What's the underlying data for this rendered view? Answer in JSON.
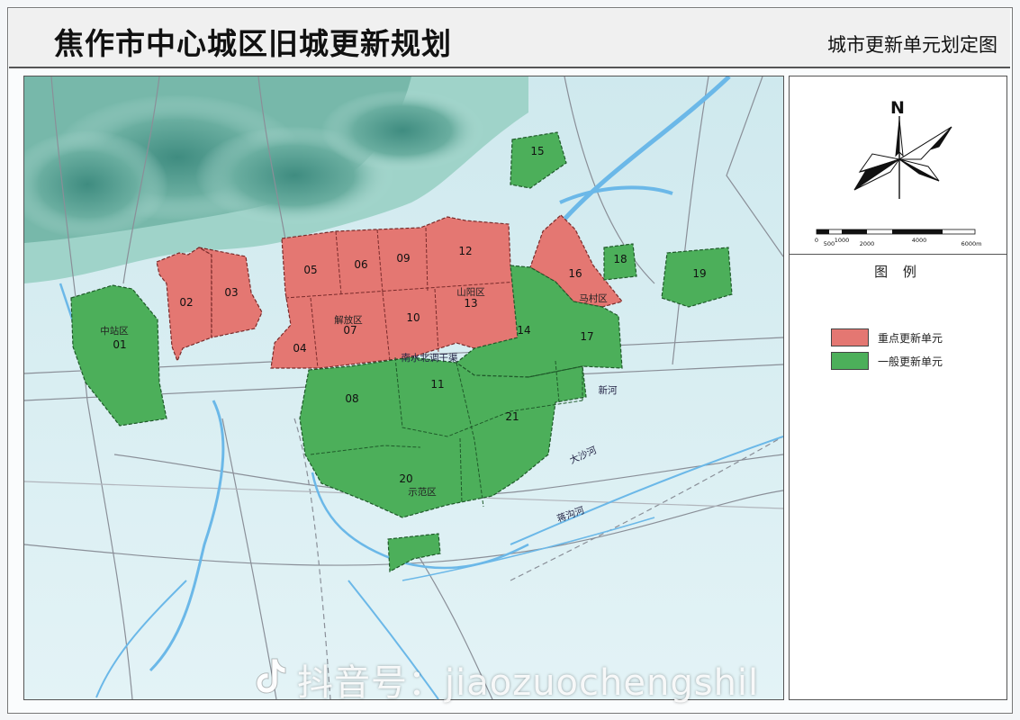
{
  "header": {
    "title": "焦作市中心城区旧城更新规划",
    "subtitle": "城市更新单元划定图"
  },
  "colors": {
    "key_unit_fill": "#e47772",
    "general_unit_fill": "#4caf5a",
    "river": "#6bb8e8",
    "mountain": "#5fa596",
    "plain": "#d8eff2"
  },
  "units": {
    "key": [
      "02",
      "03",
      "04",
      "05",
      "06",
      "07",
      "09",
      "10",
      "12",
      "13",
      "16"
    ],
    "general": [
      "01",
      "08",
      "11",
      "14",
      "15",
      "17",
      "18",
      "19",
      "20",
      "21"
    ],
    "labels": {
      "u01": "01",
      "u02": "02",
      "u03": "03",
      "u04": "04",
      "u05": "05",
      "u06": "06",
      "u07": "07",
      "u08": "08",
      "u09": "09",
      "u10": "10",
      "u11": "11",
      "u12": "12",
      "u13": "13",
      "u14": "14",
      "u15": "15",
      "u16": "16",
      "u17": "17",
      "u18": "18",
      "u19": "19",
      "u20": "20",
      "u21": "21"
    }
  },
  "districts": {
    "zhongzhan": "中站区",
    "jiefang": "解放区",
    "shanyang": "山阳区",
    "macun": "马村区",
    "shifan": "示范区"
  },
  "rivers": {
    "canal": "南水北调干渠",
    "xinhe": "新河",
    "dashahe": "大沙河",
    "wengouhe": "蒋沟河"
  },
  "compass": {
    "north_letter": "N",
    "icon": "north-arrow-icon"
  },
  "scale": {
    "ticks": [
      "0",
      "500",
      "1000",
      "2000",
      "4000",
      "6000m"
    ]
  },
  "legend": {
    "title": "图 例",
    "items": [
      {
        "label": "重点更新单元",
        "color": "#e47772"
      },
      {
        "label": "一般更新单元",
        "color": "#4caf5a"
      }
    ]
  },
  "watermark": {
    "text": "抖音号：jiaozuochengshil",
    "icon": "douyin-logo-icon"
  }
}
